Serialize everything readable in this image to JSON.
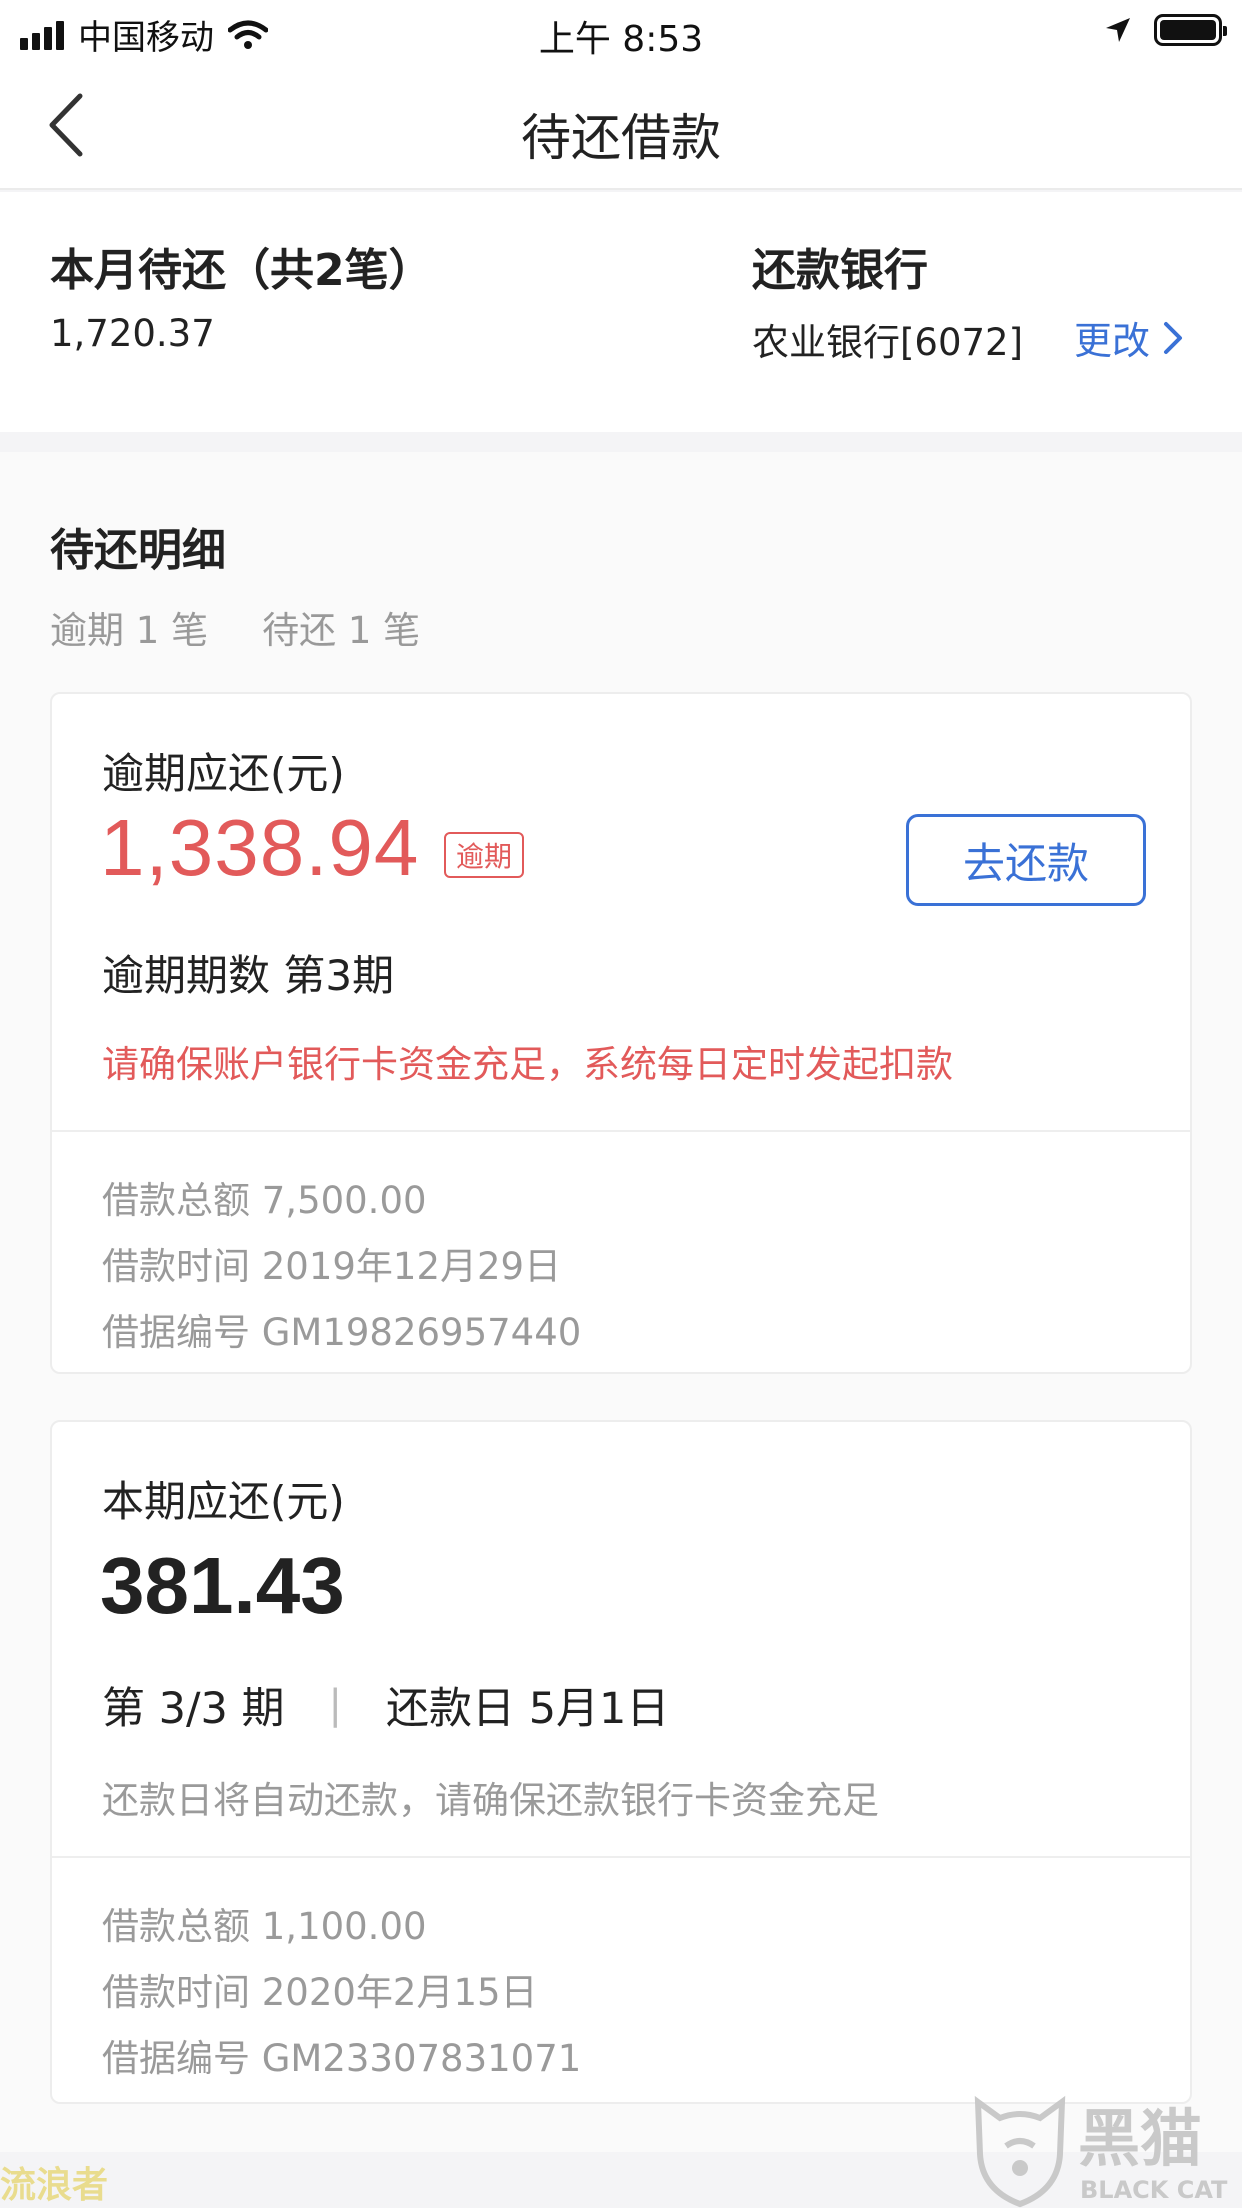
{
  "status_bar": {
    "carrier": "中国移动",
    "time": "上午 8:53"
  },
  "nav": {
    "title": "待还借款"
  },
  "summary": {
    "monthly_title": "本月待还（共2笔）",
    "monthly_amount": "1,720.37",
    "bank_title": "还款银行",
    "bank_value": "农业银行[6072]",
    "change_label": "更改"
  },
  "details": {
    "title": "待还明细",
    "overdue_count": "逾期 1 笔",
    "pending_count": "待还 1 笔"
  },
  "overdue_card": {
    "label": "逾期应还(元)",
    "amount": "1,338.94",
    "badge": "逾期",
    "repay_button": "去还款",
    "periods": "逾期期数 第3期",
    "warning": "请确保账户银行卡资金充足，系统每日定时发起扣款",
    "loan_total": "借款总额 7,500.00",
    "loan_time": "借款时间 2019年12月29日",
    "loan_id": "借据编号 GM19826957440"
  },
  "current_card": {
    "label": "本期应还(元)",
    "amount": "381.43",
    "period": "第 3/3 期",
    "separator": "|",
    "due_date": "还款日 5月1日",
    "note": "还款日将自动还款，请确保还款银行卡资金充足",
    "loan_total": "借款总额 1,100.00",
    "loan_time": "借款时间 2020年2月15日",
    "loan_id": "借据编号 GM23307831071"
  },
  "watermarks": {
    "left_text": "流浪者",
    "brand_cn": "黑猫",
    "brand_en": "BLACK CAT"
  },
  "colors": {
    "accent_blue": "#3a71d6",
    "alert_red": "#e25a5a"
  },
  "icons": [
    "signal-icon",
    "wifi-icon",
    "location-arrow-icon",
    "battery-icon",
    "back-chevron-icon",
    "chevron-right-icon",
    "black-cat-logo-icon"
  ]
}
